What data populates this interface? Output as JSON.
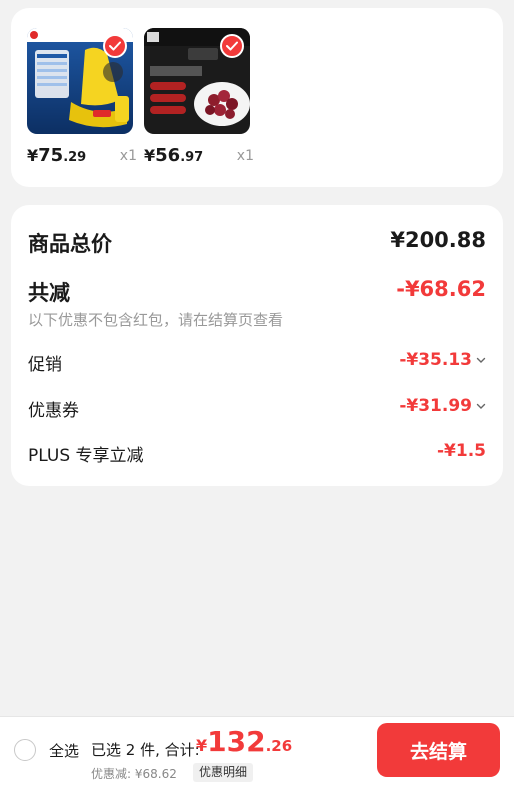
{
  "products": [
    {
      "price_symbol": "¥",
      "price_int": "75",
      "price_dec": ".29",
      "quantity": "x1",
      "selected": true,
      "image_text": {
        "brand": "公牛",
        "badge": "10米"
      }
    },
    {
      "price_symbol": "¥",
      "price_int": "56",
      "price_dec": ".97",
      "quantity": "x1",
      "selected": true,
      "image_text": {
        "brand": "牛霸气",
        "tag1": "不拼接",
        "tag2": "不合",
        "title": "牙签牛肉串"
      }
    }
  ],
  "summary": {
    "total_label": "商品总价",
    "total_value": "¥200.88",
    "reduce_label": "共减",
    "reduce_value": "-¥68.62",
    "note": "以下优惠不包含红包，请在结算页查看",
    "items": [
      {
        "label": "促销",
        "value": "-¥35.13"
      },
      {
        "label": "优惠券",
        "value": "-¥31.99"
      },
      {
        "label": "PLUS 专享立减",
        "value": "-¥1.5"
      }
    ]
  },
  "bottom": {
    "select_all": "全选",
    "selected_text": "已选 2 件, 合计:",
    "total_symbol": "¥",
    "total_int": "132",
    "total_dec": ".26",
    "discount_text": "优惠减: ¥68.62",
    "detail_label": "优惠明细",
    "checkout_label": "去结算"
  },
  "colors": {
    "accent": "#f23a3a",
    "background": "#f2f2f2",
    "muted": "#999999"
  }
}
